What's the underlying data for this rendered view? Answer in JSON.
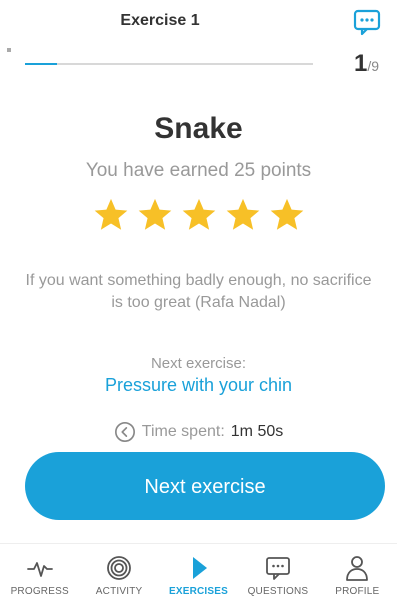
{
  "header": {
    "title": "Exercise 1",
    "step_current": "1",
    "step_total": "/9"
  },
  "progress": {
    "fraction": 0.111
  },
  "main": {
    "title": "Snake",
    "points_text": "You have earned 25 points",
    "stars": 5,
    "quote": "If you want something badly enough, no sacrifice is too great (Rafa Nadal)",
    "next_label": "Next exercise:",
    "next_name": "Pressure with your chin",
    "time_label": "Time spent:",
    "time_value": "1m 50s",
    "next_button": "Next exercise"
  },
  "nav": {
    "items": [
      {
        "label": "PROGRESS",
        "icon": "pulse-icon"
      },
      {
        "label": "ACTIVITY",
        "icon": "activity-rings-icon"
      },
      {
        "label": "EXERCISES",
        "icon": "play-icon"
      },
      {
        "label": "QUESTIONS",
        "icon": "chat-icon"
      },
      {
        "label": "PROFILE",
        "icon": "person-icon"
      }
    ]
  },
  "colors": {
    "accent": "#1aa1d9",
    "star": "#f7c027"
  }
}
